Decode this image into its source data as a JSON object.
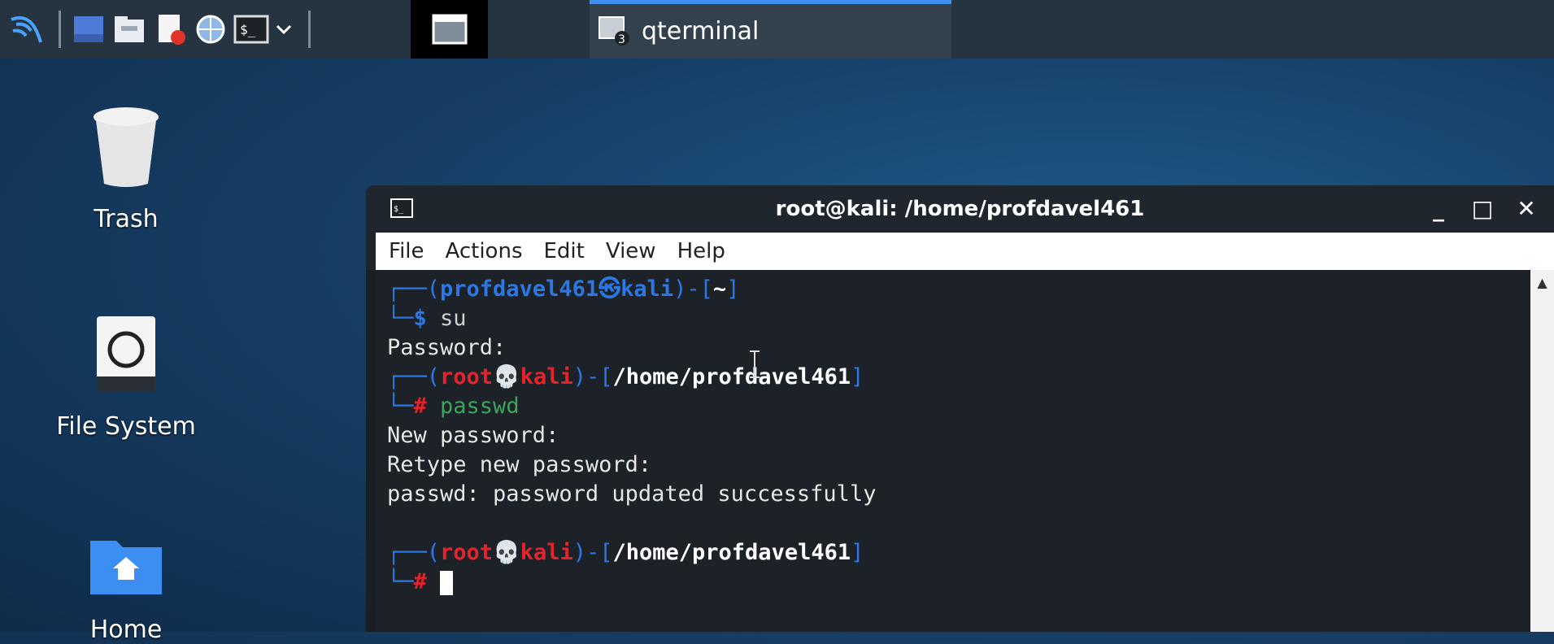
{
  "taskbar": {
    "icons": [
      "kali-menu-icon",
      "workspace-icon",
      "file-manager-icon",
      "text-editor-icon",
      "browser-icon",
      "terminal-icon",
      "chevron-down-icon"
    ],
    "active_window_label": "qterminal",
    "task_badge": "3"
  },
  "desktop": {
    "icons": [
      {
        "label": "Trash",
        "icon": "trash-icon"
      },
      {
        "label": "File System",
        "icon": "drive-icon"
      },
      {
        "label": "Home",
        "icon": "home-folder-icon"
      }
    ]
  },
  "window": {
    "title": "root@kali: /home/profdavel461",
    "menu": [
      "File",
      "Actions",
      "Edit",
      "View",
      "Help"
    ],
    "controls": {
      "minimize": "_",
      "maximize": "□",
      "close": "✕"
    }
  },
  "terminal": {
    "prompt1": {
      "corner": "┌──(",
      "user": "profdavel461",
      "at": "㉿",
      "host": "kali",
      "mid": ")-[",
      "path": "~",
      "end": "]"
    },
    "prompt1_cmd_prefix": "└─",
    "prompt1_sym": "$",
    "prompt1_cmd": " su",
    "line_password": "Password:",
    "prompt2": {
      "corner": "┌──(",
      "user": "root",
      "at": "💀",
      "host": "kali",
      "mid": ")-[",
      "path": "/home/profdavel461",
      "end": "]"
    },
    "prompt2_cmd_prefix": "└─",
    "prompt2_sym": "#",
    "prompt2_cmd": " passwd",
    "line_new": "New password:",
    "line_retype": "Retype new password:",
    "line_success": "passwd: password updated successfully",
    "prompt3": {
      "corner": "┌──(",
      "user": "root",
      "at": "💀",
      "host": "kali",
      "mid": ")-[",
      "path": "/home/profdavel461",
      "end": "]"
    },
    "prompt3_cmd_prefix": "└─",
    "prompt3_sym": "#"
  },
  "colors": {
    "accent": "#3f8ef0",
    "prompt_user_blue": "#2b78e4",
    "root_red": "#e3242b",
    "cmd_green": "#3aa65a"
  }
}
